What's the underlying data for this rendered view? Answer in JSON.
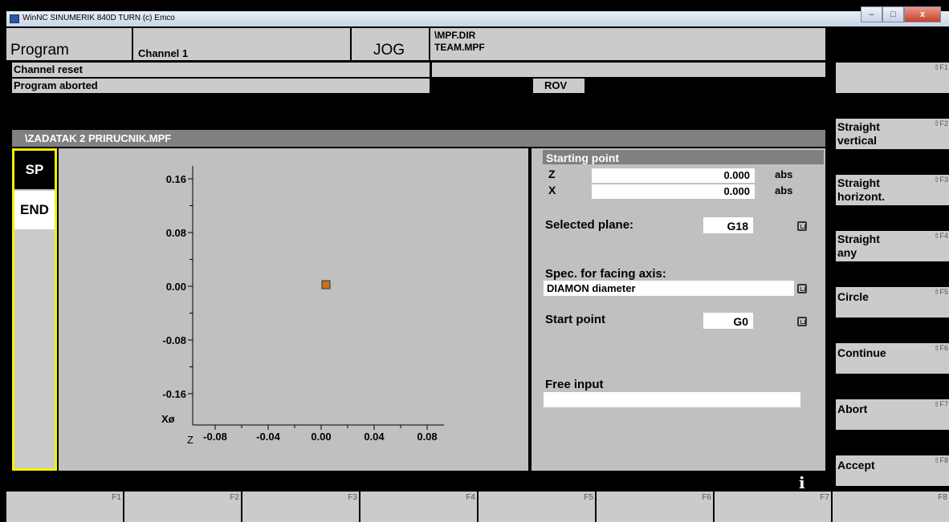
{
  "window": {
    "title": "WinNC SINUMERIK 840D TURN (c) Emco",
    "buttons": [
      "–",
      "□",
      "x"
    ]
  },
  "header": {
    "mode": "Program",
    "channel": "Channel 1",
    "operating_mode": "JOG",
    "path_dir": "\\MPF.DIR",
    "path_file": "TEAM.MPF",
    "alarm_line1": "Channel reset",
    "alarm_line2": "Program aborted",
    "override": "ROV"
  },
  "program_title": "\\ZADATAK 2 PRIRUCNIK.MPF",
  "left_keys": [
    "SP",
    "END"
  ],
  "graph": {
    "y_ticks": [
      "0.16",
      "0.08",
      "0.00",
      "-0.08",
      "-0.16"
    ],
    "x_ticks": [
      "-0.08",
      "-0.04",
      "0.00",
      "0.04",
      "0.08"
    ],
    "y_axis_label": "Xø",
    "x_axis_label": "Z",
    "point_color": "#c8701a"
  },
  "form": {
    "section_title": "Starting point",
    "z_label": "Z",
    "z_value": "0.000",
    "z_unit": "abs",
    "x_label": "X",
    "x_value": "0.000",
    "x_unit": "abs",
    "plane_label": "Selected plane:",
    "plane_value": "G18",
    "facing_label": "Spec. for facing axis:",
    "facing_value": "DIAMON diameter",
    "start_label": "Start point",
    "start_value": "G0",
    "free_label": "Free input",
    "free_value": ""
  },
  "right_keys": [
    {
      "label": "",
      "key": "⇧F1"
    },
    {
      "label": "Straight vertical",
      "key": "⇧F2"
    },
    {
      "label": "Straight horizont.",
      "key": "⇧F3"
    },
    {
      "label": "Straight any",
      "key": "⇧F4"
    },
    {
      "label": "Circle",
      "key": "⇧F5"
    },
    {
      "label": "Continue",
      "key": "⇧F6"
    },
    {
      "label": "Abort",
      "key": "⇧F7"
    },
    {
      "label": "Accept",
      "key": "⇧F8"
    }
  ],
  "bottom_keys": [
    "F1",
    "F2",
    "F3",
    "F4",
    "F5",
    "F6",
    "F7",
    "F8"
  ],
  "info_icon": "i",
  "colors": {
    "panel_gray": "#cbcbcb",
    "title_bar_gray": "#808080",
    "highlight_yellow": "#f6f200"
  }
}
